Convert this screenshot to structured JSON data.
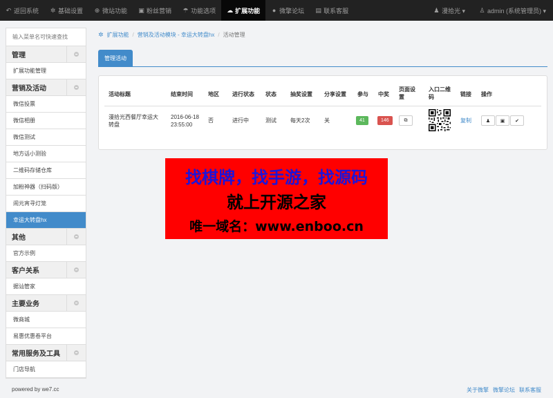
{
  "topnav": {
    "items": [
      {
        "icon": "back-icon",
        "glyph": "↶",
        "label": "返回系统"
      },
      {
        "icon": "gear-icon",
        "glyph": "✲",
        "label": "基础设置"
      },
      {
        "icon": "globe-icon",
        "glyph": "⊕",
        "label": "微站功能"
      },
      {
        "icon": "users-icon",
        "glyph": "▣",
        "label": "粉丝营销"
      },
      {
        "icon": "umbrella-icon",
        "glyph": "☂",
        "label": "功能选项"
      },
      {
        "icon": "extension-icon",
        "glyph": "☁",
        "label": "扩展功能"
      },
      {
        "icon": "chat-icon",
        "glyph": "●",
        "label": "微擎论坛"
      },
      {
        "icon": "support-icon",
        "glyph": "▤",
        "label": "联系客服"
      }
    ],
    "user": {
      "icon": "group-icon",
      "glyph": "♟",
      "label": "漫拾光 ▾"
    },
    "admin": {
      "icon": "user-icon",
      "glyph": "♙",
      "label": "admin (系统管理员) ▾"
    }
  },
  "sidebar": {
    "search_placeholder": "输入菜单名可快速查找",
    "groups": [
      {
        "title": "管理",
        "items": [
          "扩展功能管理"
        ]
      },
      {
        "title": "营销及活动",
        "items": [
          "微信投票",
          "微信相册",
          "微信测试",
          "地方话小测验",
          "二维码存储仓库",
          "加粉神器（扫码版）",
          "闹元宵寻灯笼",
          "幸运大转盘hx"
        ]
      },
      {
        "title": "其他",
        "items": [
          "官方示例"
        ]
      },
      {
        "title": "客户关系",
        "items": [
          "据讪管家"
        ]
      },
      {
        "title": "主要业务",
        "items": [
          "微商城",
          "易惠优惠卷平台"
        ]
      },
      {
        "title": "常用服务及工具",
        "items": [
          "门店导航"
        ]
      }
    ]
  },
  "breadcrumb": {
    "root": "扩展功能",
    "module": "营销及活动模块 - 幸运大转盘hx",
    "current": "活动管理"
  },
  "tabs": {
    "active": "管理活动"
  },
  "table": {
    "headers": {
      "title": "活动标题",
      "end_time": "结束时间",
      "region": "地区",
      "progress": "进行状态",
      "status": "状态",
      "lottery": "抽奖设置",
      "share": "分享设置",
      "join": "参与",
      "win": "中奖",
      "page1": "页面设",
      "page2": "置",
      "qr1": "入口二维",
      "qr2": "码",
      "link": "链接",
      "ops": "操作"
    },
    "row": {
      "title_line1": "漫拾光西餐厅幸运大",
      "title_line2": "转盘",
      "end_date": "2016-06-18",
      "end_clock": "23:55:00",
      "region": "否",
      "progress": "进行中",
      "status": "测试",
      "lottery": "每天2次",
      "share": "关",
      "join": "41",
      "win": "146",
      "link": "复制"
    }
  },
  "ad": {
    "line1": "找棋牌，找手游，找源码",
    "line2": "就上开源之家",
    "line3": "唯一域名：www.enboo.cn"
  },
  "footer": {
    "powered": "powered by we7.cc",
    "links": [
      "关于微擎",
      "微擎论坛",
      "联系客服"
    ]
  },
  "colors": {
    "accent": "#428bca",
    "nav_bg": "#222222",
    "ad_bg": "#ff0000",
    "ad_headline": "#1e14d8",
    "badge_green": "#5cb85c",
    "badge_red": "#d9534f"
  }
}
